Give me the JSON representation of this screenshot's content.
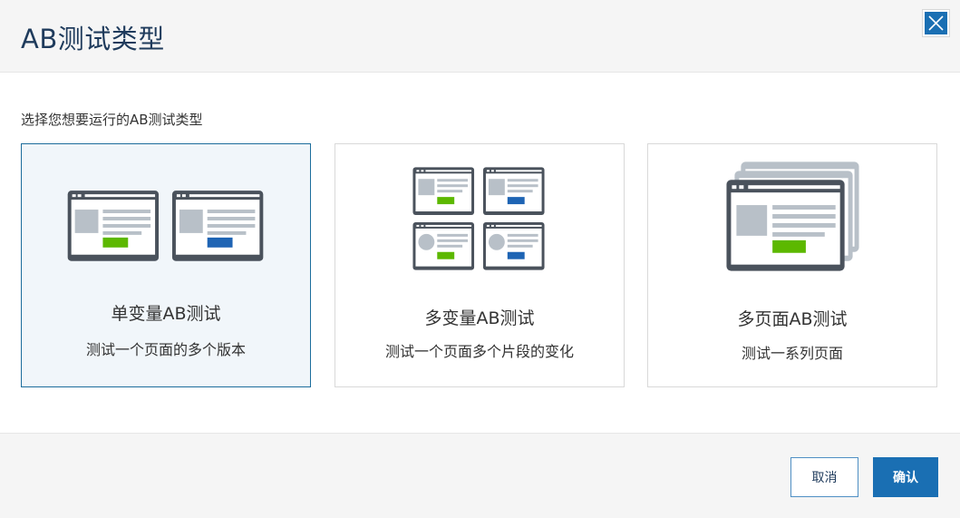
{
  "dialog": {
    "title": "AB测试类型",
    "close_icon": "close-icon"
  },
  "prompt": "选择您想要运行的AB测试类型",
  "cards": [
    {
      "name": "单变量AB测试",
      "desc": "测试一个页面的多个版本",
      "selected": true,
      "icon": "two-page-versions-icon"
    },
    {
      "name": "多变量AB测试",
      "desc": "测试一个页面多个片段的变化",
      "selected": false,
      "icon": "four-page-variants-icon"
    },
    {
      "name": "多页面AB测试",
      "desc": "测试一系列页面",
      "selected": false,
      "icon": "stacked-pages-icon"
    }
  ],
  "footer": {
    "cancel_label": "取消",
    "confirm_label": "确认"
  },
  "colors": {
    "accent": "#1a6fb3",
    "title": "#1f3b5c",
    "frame": "#4a525c",
    "placeholder": "#b8c0c8",
    "green": "#5cb800",
    "blue": "#1e64b4",
    "selected_bg": "#f1f6fa",
    "selected_border": "#1c6d9c"
  }
}
